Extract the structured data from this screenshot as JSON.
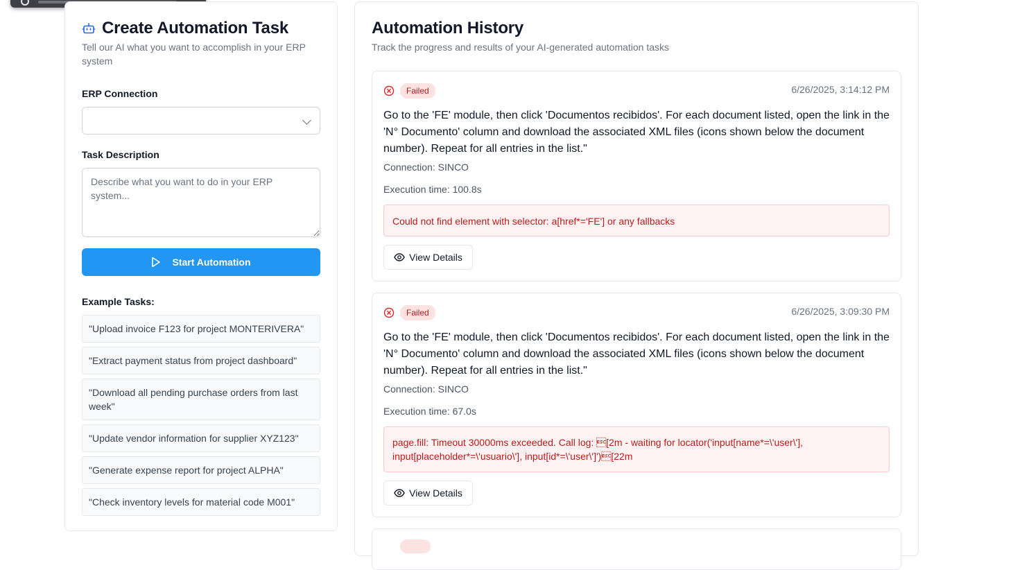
{
  "create": {
    "title": "Create Automation Task",
    "subtitle": "Tell our AI what you want to accomplish in your ERP system",
    "erp_label": "ERP Connection",
    "erp_value": "",
    "task_label": "Task Description",
    "task_placeholder": "Describe what you want to do in your ERP system...",
    "start_label": "Start Automation",
    "examples_label": "Example Tasks:",
    "examples": [
      "\"Upload invoice F123 for project MONTERIVERA\"",
      "\"Extract payment status from project dashboard\"",
      "\"Download all pending purchase orders from last week\"",
      "\"Update vendor information for supplier XYZ123\"",
      "\"Generate expense report for project ALPHA\"",
      "\"Check inventory levels for material code M001\""
    ]
  },
  "history": {
    "title": "Automation History",
    "subtitle": "Track the progress and results of your AI-generated automation tasks",
    "tasks": [
      {
        "status": "Failed",
        "timestamp": "6/26/2025, 3:14:12 PM",
        "description": "Go to the 'FE' module, then click 'Documentos recibidos'. For each document listed, open the link in the 'N° Documento' column and download the associated XML files (icons shown below the document number). Repeat for all entries in the list.\"",
        "connection": "Connection: SINCO",
        "execution_time": "Execution time: 100.8s",
        "error": "Could not find element with selector: a[href*='FE'] or any fallbacks",
        "details_label": "View Details"
      },
      {
        "status": "Failed",
        "timestamp": "6/26/2025, 3:09:30 PM",
        "description": "Go to the 'FE' module, then click 'Documentos recibidos'. For each document listed, open the link in the 'N° Documento' column and download the associated XML files (icons shown below the document number). Repeat for all entries in the list.\"",
        "connection": "Connection: SINCO",
        "execution_time": "Execution time: 67.0s",
        "error": "page.fill: Timeout 30000ms exceeded. Call log: \u001b[2m - waiting for locator('input[name*=\\'user\\'], input[placeholder*=\\'usuario\\'], input[id*=\\'user\\']')\u001b[22m",
        "details_label": "View Details"
      }
    ]
  },
  "colors": {
    "primary": "#2196f3",
    "failed_bg": "#fde2e2",
    "failed_text": "#b91c1c",
    "error_bg": "#fef2f2",
    "icon_blue": "#2563eb"
  }
}
